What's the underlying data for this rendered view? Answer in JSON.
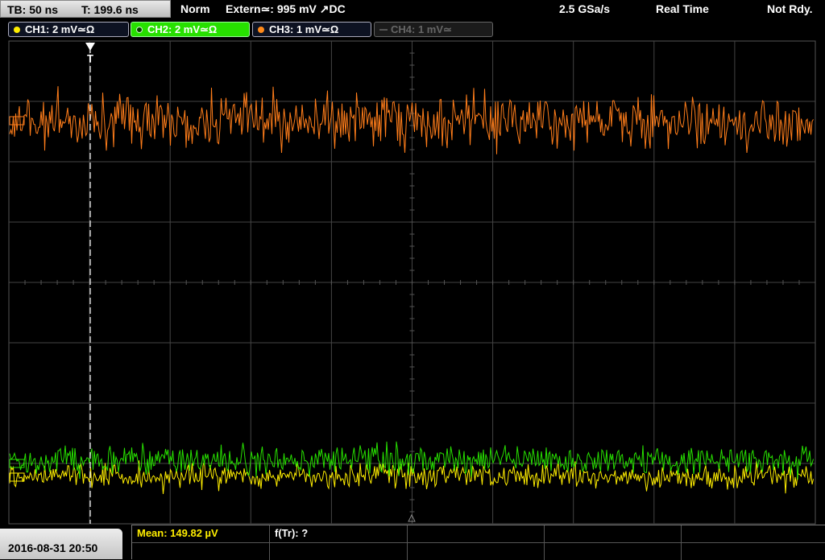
{
  "status_bar": {
    "timebase": "TB: 50 ns",
    "trigger_time": "T: 199.6 ns",
    "acq_mode": "Norm",
    "trigger_source": "Extern≃: 995 mV ↗DC",
    "sample_rate": "2.5 GSa/s",
    "run_mode": "Real Time",
    "trigger_state": "Not Rdy."
  },
  "channels": [
    {
      "label": "CH1: 2 mV≃Ω",
      "color": "#ffee00",
      "active": true
    },
    {
      "label": "CH2: 2 mV≃Ω",
      "color": "#27e000",
      "active": true
    },
    {
      "label": "CH3: 1 mV≃Ω",
      "color": "#ff8a1a",
      "active": true
    },
    {
      "label": "CH4: 1 mV≃",
      "color": "#666666",
      "active": false
    }
  ],
  "trigger_marker": "T",
  "datetime": "2016-08-31 20:50",
  "measurements": {
    "mean": "Mean: 149.82 µV",
    "frequency": "f(Tr): ?"
  },
  "colors": {
    "grid": "#444444",
    "background": "#000000",
    "accent": "#27e000"
  }
}
